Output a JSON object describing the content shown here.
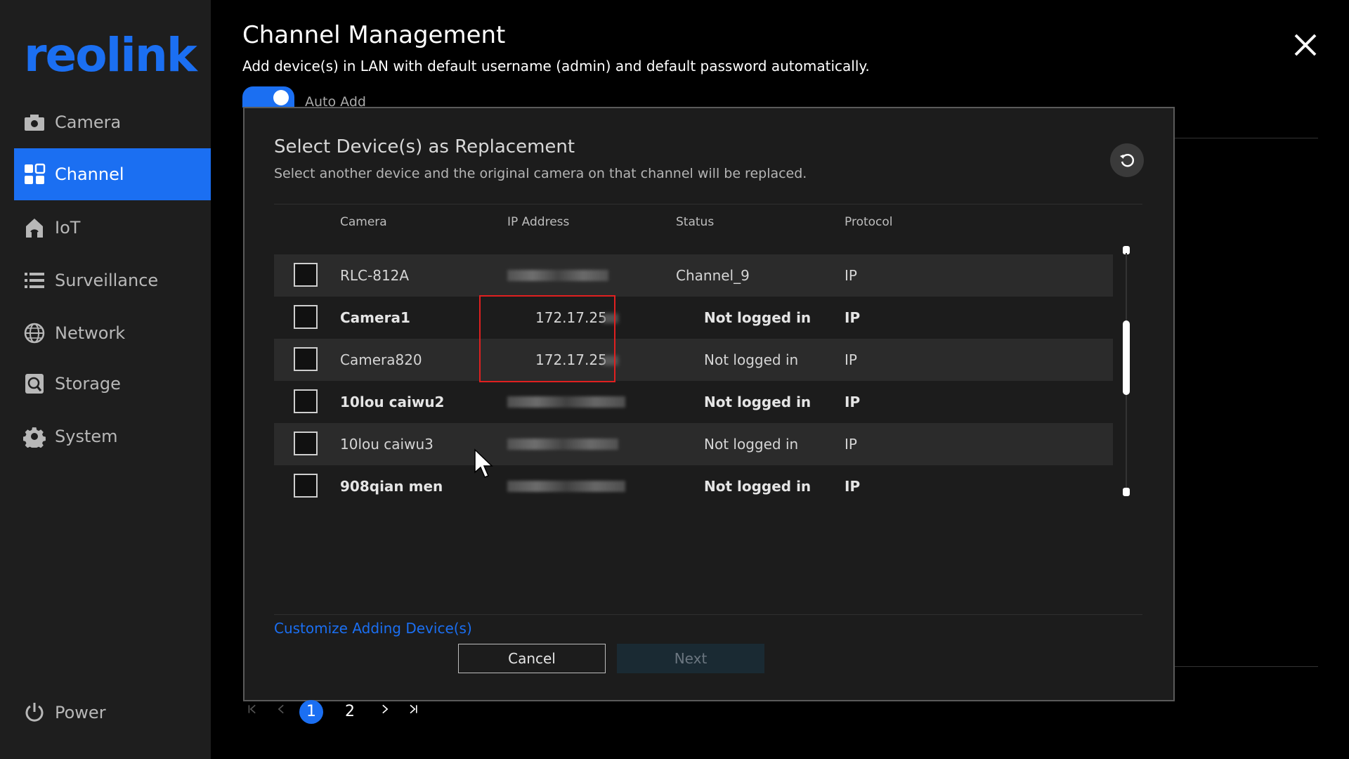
{
  "brand": {
    "logo_text": "reolink",
    "accent": "#1b6ff2"
  },
  "sidebar": {
    "items": [
      {
        "label": "Camera",
        "icon": "camera-icon",
        "active": false
      },
      {
        "label": "Channel",
        "icon": "grid-icon",
        "active": true
      },
      {
        "label": "IoT",
        "icon": "home-icon",
        "active": false
      },
      {
        "label": "Surveillance",
        "icon": "list-icon",
        "active": false
      },
      {
        "label": "Network",
        "icon": "globe-icon",
        "active": false
      },
      {
        "label": "Storage",
        "icon": "storage-icon",
        "active": false
      },
      {
        "label": "System",
        "icon": "gear-icon",
        "active": false
      }
    ],
    "power_label": "Power"
  },
  "header": {
    "title": "Channel Management",
    "subtitle": "Add device(s) in LAN with default username (admin) and default password automatically.",
    "toggle_label": "Auto Add"
  },
  "modal": {
    "title": "Select Device(s) as Replacement",
    "subtitle": "Select another device and the original camera on that channel will be replaced.",
    "columns": {
      "camera": "Camera",
      "ip": "IP Address",
      "status": "Status",
      "protocol": "Protocol"
    },
    "rows": [
      {
        "camera": "RLC-812A",
        "ip": "",
        "status": "Channel_9",
        "protocol": "IP"
      },
      {
        "camera": "Camera1",
        "ip": "172.17.25",
        "status": "Not logged in",
        "protocol": "IP"
      },
      {
        "camera": "Camera820",
        "ip": "172.17.25",
        "status": "Not logged in",
        "protocol": "IP"
      },
      {
        "camera": "10lou caiwu2",
        "ip": "",
        "status": "Not logged in",
        "protocol": "IP"
      },
      {
        "camera": "10lou caiwu3",
        "ip": "",
        "status": "Not logged in",
        "protocol": "IP"
      },
      {
        "camera": "908qian men",
        "ip": "",
        "status": "Not logged in",
        "protocol": "IP"
      }
    ],
    "customize_link": "Customize Adding Device(s)",
    "cancel_label": "Cancel",
    "next_label": "Next"
  },
  "pagination": {
    "pages": [
      "1",
      "2"
    ],
    "current": "1"
  }
}
